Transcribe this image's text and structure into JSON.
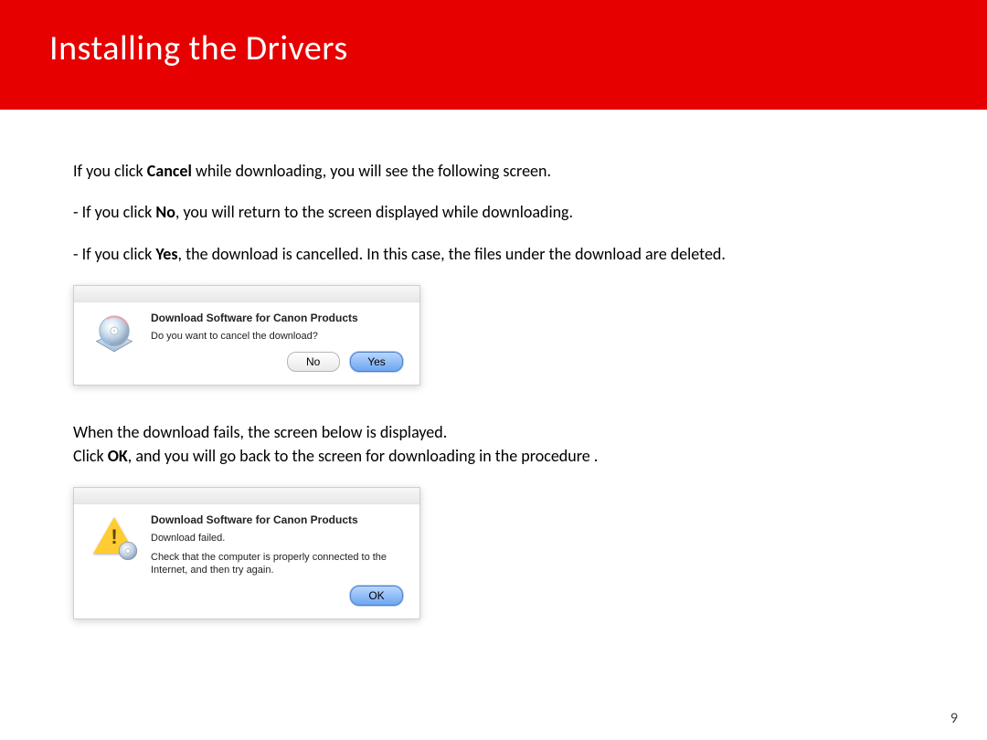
{
  "header": {
    "title": "Installing  the Drivers"
  },
  "body": {
    "line1_pre": "If you click ",
    "line1_bold": "Cancel",
    "line1_post": " while downloading, you will see the following screen.",
    "bullet_no_pre": "- If you click ",
    "bullet_no_bold": "No",
    "bullet_no_post": ", you will return to the screen displayed while downloading.",
    "bullet_yes_pre": "- If you click ",
    "bullet_yes_bold": "Yes",
    "bullet_yes_post": ", the download is cancelled. In this case, the files under the download are deleted.",
    "section2_line1": "When the download fails, the screen below is displayed.",
    "section2_line2_pre": "Click ",
    "section2_line2_bold": "OK",
    "section2_line2_post": ", and you will go back to the screen for downloading in the procedure ."
  },
  "dialog1": {
    "title": "Download Software for Canon Products",
    "message": "Do you want to cancel the download?",
    "no_label": "No",
    "yes_label": "Yes"
  },
  "dialog2": {
    "title": "Download Software for Canon Products",
    "message1": "Download failed.",
    "message2": "Check that the computer is properly connected to the Internet, and then try again.",
    "ok_label": "OK"
  },
  "page_number": "9"
}
